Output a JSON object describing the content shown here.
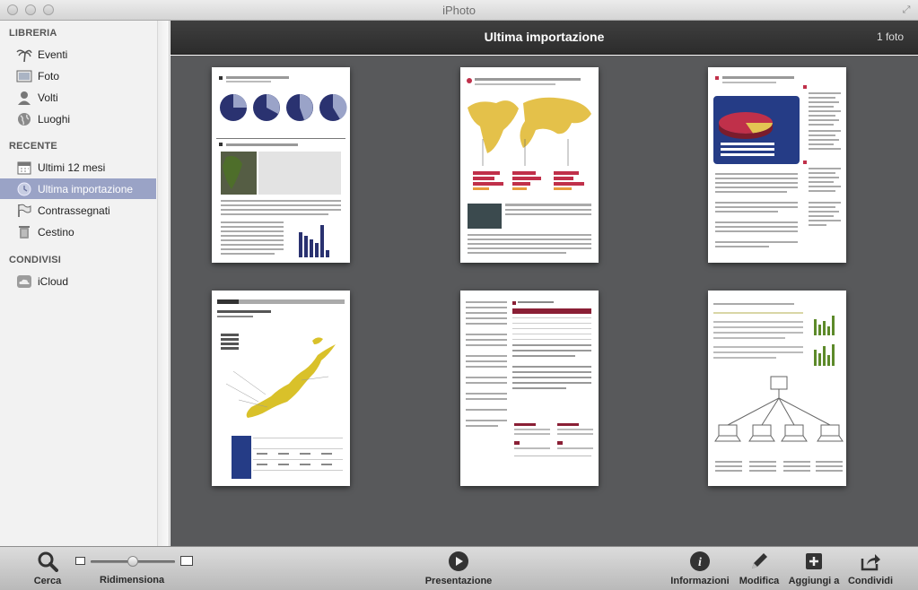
{
  "window": {
    "title": "iPhoto"
  },
  "sidebar": {
    "sections": [
      {
        "title": "LIBRERIA",
        "items": [
          {
            "label": "Eventi",
            "icon": "palm-tree-icon"
          },
          {
            "label": "Foto",
            "icon": "photo-icon"
          },
          {
            "label": "Volti",
            "icon": "face-icon"
          },
          {
            "label": "Luoghi",
            "icon": "globe-icon"
          }
        ]
      },
      {
        "title": "RECENTE",
        "items": [
          {
            "label": "Ultimi 12 mesi",
            "icon": "calendar-icon"
          },
          {
            "label": "Ultima importazione",
            "icon": "import-clock-icon",
            "selected": true
          },
          {
            "label": "Contrassegnati",
            "icon": "flag-icon"
          },
          {
            "label": "Cestino",
            "icon": "trash-icon"
          }
        ]
      },
      {
        "title": "CONDIVISI",
        "items": [
          {
            "label": "iCloud",
            "icon": "icloud-icon"
          }
        ]
      }
    ]
  },
  "content": {
    "title": "Ultima importazione",
    "count": "1 foto"
  },
  "toolbar": {
    "search_label": "Cerca",
    "resize_label": "Ridimensiona",
    "slideshow_label": "Presentazione",
    "info_label": "Informazioni",
    "edit_label": "Modifica",
    "add_label": "Aggiungi a",
    "share_label": "Condividi",
    "zoom_level": 0.5
  },
  "colors": {
    "selection": "#9aa3c6",
    "grid_background": "#58595b",
    "header": "#333333"
  }
}
